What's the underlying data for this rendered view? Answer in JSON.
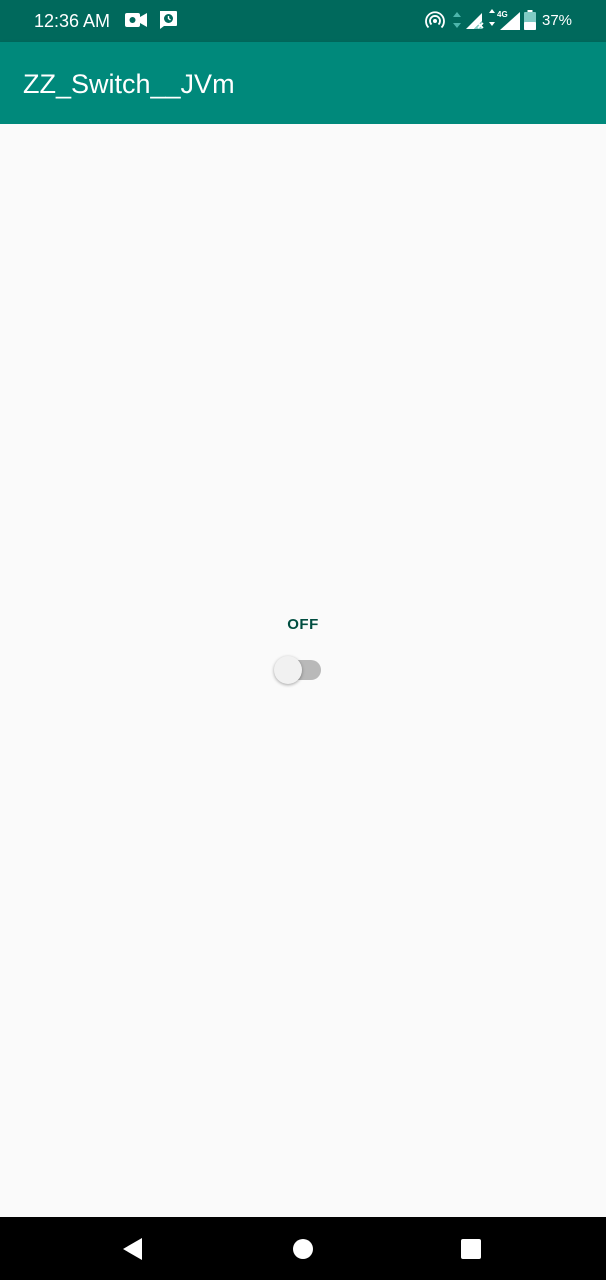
{
  "status_bar": {
    "time": "12:36 AM",
    "battery_percent": "37%",
    "network_label": "4G",
    "icons": [
      "video-camera-icon",
      "alarm-icon",
      "hotspot-icon",
      "data-arrows-icon",
      "signal-no-sim-icon",
      "signal-4g-icon",
      "battery-icon"
    ]
  },
  "app_bar": {
    "title": "ZZ_Switch__JVm",
    "background": "#00897b"
  },
  "main": {
    "switch_label": "OFF",
    "switch_checked": false
  },
  "nav_bar": {
    "icons": [
      "back-icon",
      "home-icon",
      "recents-icon"
    ]
  },
  "colors": {
    "status_bar": "#00695c",
    "app_bar": "#00897b",
    "label_text": "#004d40",
    "content_background": "#fafafa"
  }
}
